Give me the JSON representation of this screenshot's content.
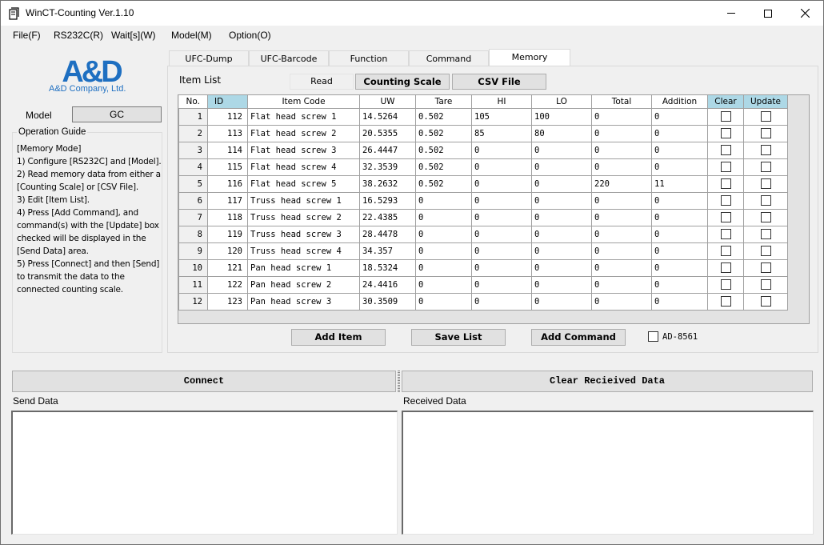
{
  "window": {
    "title": "WinCT-Counting Ver.1.10",
    "controls": {
      "minimize": "—",
      "maximize": "☐",
      "close": "✕"
    }
  },
  "menu": [
    "File(F)",
    "RS232C(R)",
    "Wait[s](W)",
    "Model(M)",
    "Option(O)"
  ],
  "left_panel": {
    "logo_text": "A&D Company, Ltd.",
    "model_label": "Model",
    "model_value": "GC",
    "guide_title": "Operation Guide",
    "guide_text": "[Memory Mode]\n1) Configure [RS232C] and [Model].\n2) Read memory data from either a [Counting Scale] or [CSV File].\n3) Edit [Item List].\n4) Press [Add Command], and command(s) with the [Update] box checked will be displayed in the [Send Data] area.\n5) Press [Connect] and then [Send] to transmit the data to the connected counting scale."
  },
  "tabs": [
    {
      "label": "UFC-Dump",
      "active": false
    },
    {
      "label": "UFC-Barcode",
      "active": false
    },
    {
      "label": "Function",
      "active": false
    },
    {
      "label": "Command",
      "active": false
    },
    {
      "label": "Memory",
      "active": true
    }
  ],
  "memory": {
    "item_list_label": "Item List",
    "read_label": "Read",
    "counting_scale_btn": "Counting Scale",
    "csv_file_btn": "CSV File",
    "columns": [
      "No.",
      "ID",
      "Item Code",
      "UW",
      "Tare",
      "HI",
      "LO",
      "Total",
      "Addition",
      "Clear",
      "Update"
    ],
    "highlight_color": "#add8e6",
    "rows": [
      {
        "no": "1",
        "id": "112",
        "code": "Flat head screw 1",
        "uw": "14.5264",
        "tare": "0.502",
        "hi": "105",
        "lo": "100",
        "total": "0",
        "addition": "0",
        "clear": false,
        "update": false
      },
      {
        "no": "2",
        "id": "113",
        "code": "Flat head screw 2",
        "uw": "20.5355",
        "tare": "0.502",
        "hi": "85",
        "lo": "80",
        "total": "0",
        "addition": "0",
        "clear": false,
        "update": false
      },
      {
        "no": "3",
        "id": "114",
        "code": "Flat head screw 3",
        "uw": "26.4447",
        "tare": "0.502",
        "hi": "0",
        "lo": "0",
        "total": "0",
        "addition": "0",
        "clear": false,
        "update": false
      },
      {
        "no": "4",
        "id": "115",
        "code": "Flat head screw 4",
        "uw": "32.3539",
        "tare": "0.502",
        "hi": "0",
        "lo": "0",
        "total": "0",
        "addition": "0",
        "clear": false,
        "update": false
      },
      {
        "no": "5",
        "id": "116",
        "code": "Flat head screw 5",
        "uw": "38.2632",
        "tare": "0.502",
        "hi": "0",
        "lo": "0",
        "total": "220",
        "addition": "11",
        "clear": false,
        "update": false
      },
      {
        "no": "6",
        "id": "117",
        "code": "Truss head screw 1",
        "uw": "16.5293",
        "tare": "0",
        "hi": "0",
        "lo": "0",
        "total": "0",
        "addition": "0",
        "clear": false,
        "update": false
      },
      {
        "no": "7",
        "id": "118",
        "code": "Truss head screw 2",
        "uw": "22.4385",
        "tare": "0",
        "hi": "0",
        "lo": "0",
        "total": "0",
        "addition": "0",
        "clear": false,
        "update": false
      },
      {
        "no": "8",
        "id": "119",
        "code": "Truss head screw 3",
        "uw": "28.4478",
        "tare": "0",
        "hi": "0",
        "lo": "0",
        "total": "0",
        "addition": "0",
        "clear": false,
        "update": false
      },
      {
        "no": "9",
        "id": "120",
        "code": "Truss head screw 4",
        "uw": "34.357",
        "tare": "0",
        "hi": "0",
        "lo": "0",
        "total": "0",
        "addition": "0",
        "clear": false,
        "update": false
      },
      {
        "no": "10",
        "id": "121",
        "code": "Pan head screw 1",
        "uw": "18.5324",
        "tare": "0",
        "hi": "0",
        "lo": "0",
        "total": "0",
        "addition": "0",
        "clear": false,
        "update": false
      },
      {
        "no": "11",
        "id": "122",
        "code": "Pan head screw 2",
        "uw": "24.4416",
        "tare": "0",
        "hi": "0",
        "lo": "0",
        "total": "0",
        "addition": "0",
        "clear": false,
        "update": false
      },
      {
        "no": "12",
        "id": "123",
        "code": "Pan head screw 3",
        "uw": "30.3509",
        "tare": "0",
        "hi": "0",
        "lo": "0",
        "total": "0",
        "addition": "0",
        "clear": false,
        "update": false
      }
    ],
    "add_item_btn": "Add Item",
    "save_list_btn": "Save List",
    "add_command_btn": "Add Command",
    "ad8561_label": "AD-8561",
    "ad8561_checked": false
  },
  "bottom": {
    "connect_btn": "Connect",
    "clear_received_btn": "Clear Recieived Data",
    "send_label": "Send Data",
    "received_label": "Received Data",
    "send_value": "",
    "received_value": ""
  }
}
